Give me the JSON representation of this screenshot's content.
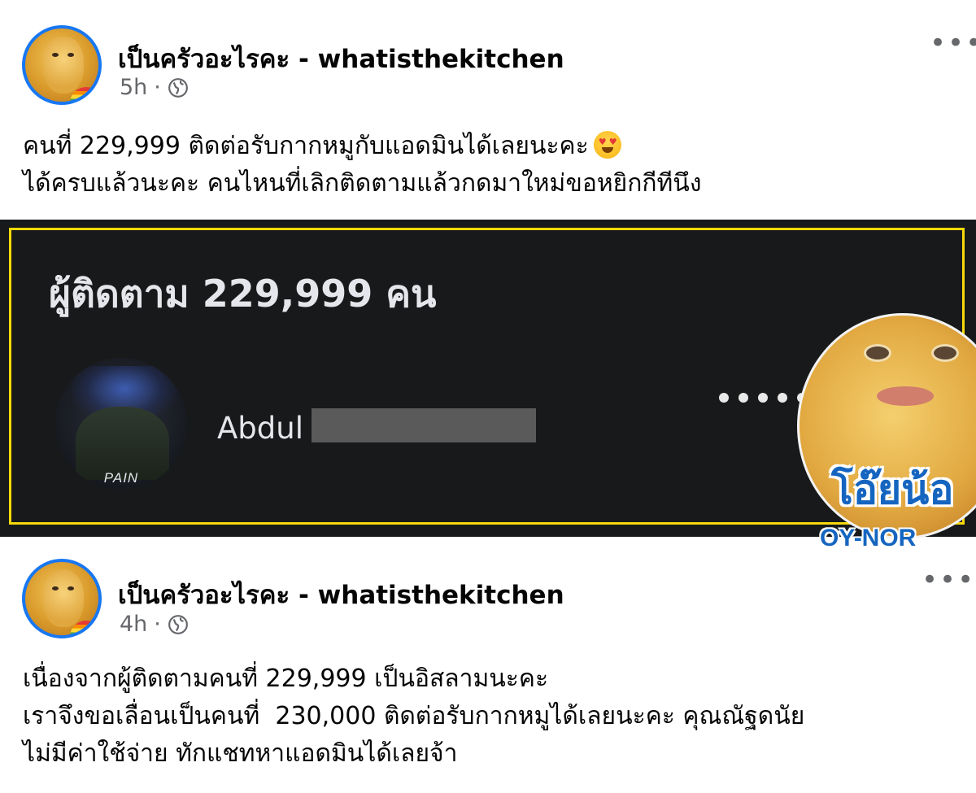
{
  "post1": {
    "page_name": "เป็นครัวอะไรคะ - whatisthekitchen",
    "time": "5h",
    "text_line1": "คนที่ 229,999 ติดต่อรับกากหมูกับแอดมินได้เลยนะคะ",
    "emoji": "smiling-face-with-heart-eyes",
    "text_line2": "ได้ครบแล้วนะคะ คนไหนที่เลิกติดตามแล้วกดมาใหม่ขอหยิกกีทีนึง"
  },
  "screenshot": {
    "followers_title": "ผู้ติดตาม 229,999 คน",
    "follower_name": "Abdul",
    "follower_avatar_tag": "PAIN"
  },
  "sticker": {
    "text_th": "โอ๊ยน้อ",
    "text_en": "OY-NOR"
  },
  "post2": {
    "page_name": "เป็นครัวอะไรคะ - whatisthekitchen",
    "time": "4h",
    "text_line1": "เนื่องจากผู้ติดตามคนที่ 229,999 เป็นอิสลามนะคะ",
    "text_line2": "เราจึงขอเลื่อนเป็นคนที่  230,000 ติดต่อรับกากหมูได้เลยนะคะ คุณณัฐดนัย",
    "text_line3": "ไม่มีค่าใช้จ่าย ทักแชทหาแอดมินได้เลยจ้า"
  },
  "colors": {
    "accent": "#1877f2",
    "highlight_border": "#f5d90a",
    "dark_bg": "#18191a"
  }
}
